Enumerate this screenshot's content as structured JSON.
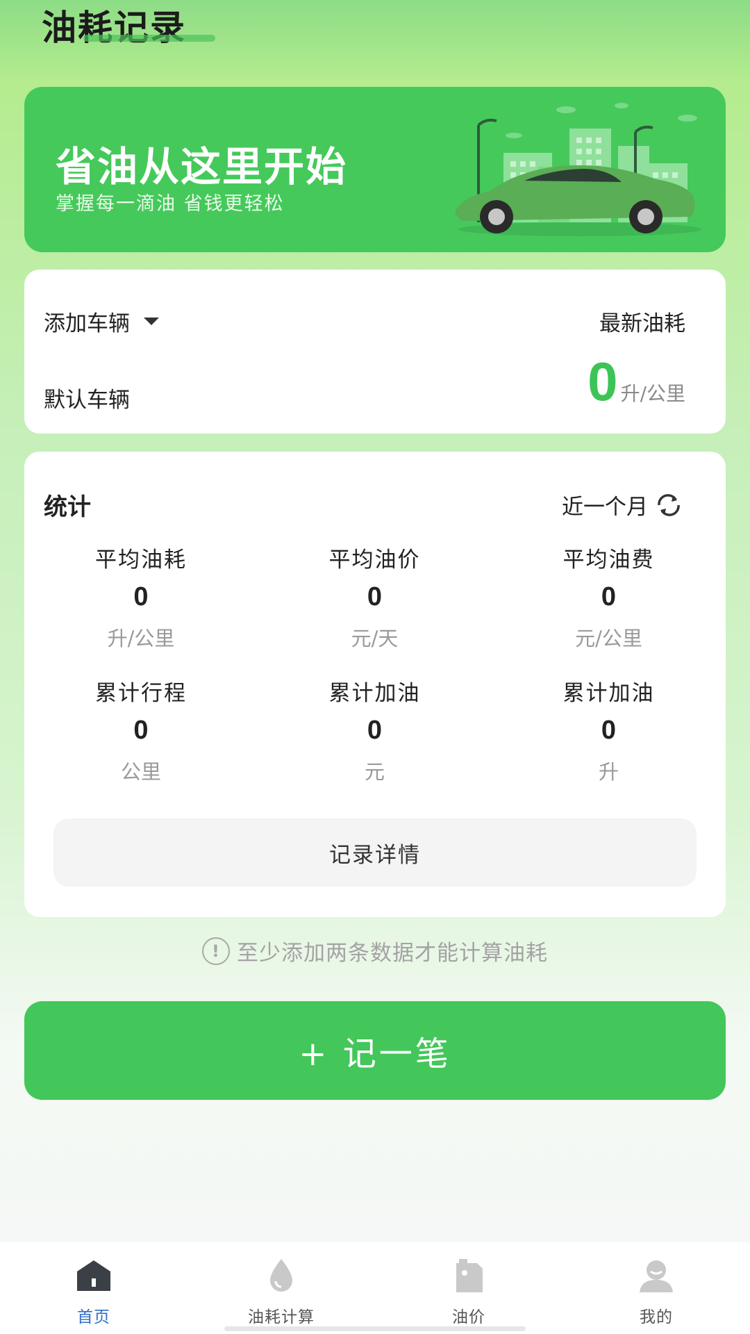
{
  "header": {
    "title": "油耗记录"
  },
  "banner": {
    "title": "省油从这里开始",
    "subtitle": "掌握每一滴油 省钱更轻松"
  },
  "vehicle": {
    "select_label": "添加车辆",
    "latest_label": "最新油耗",
    "name": "默认车辆",
    "latest_value": "0",
    "latest_unit": "升/公里"
  },
  "stats": {
    "title": "统计",
    "period": "近一个月",
    "items": [
      {
        "label": "平均油耗",
        "value": "0",
        "unit": "升/公里"
      },
      {
        "label": "平均油价",
        "value": "0",
        "unit": "元/天"
      },
      {
        "label": "平均油费",
        "value": "0",
        "unit": "元/公里"
      },
      {
        "label": "累计行程",
        "value": "0",
        "unit": "公里"
      },
      {
        "label": "累计加油",
        "value": "0",
        "unit": "元"
      },
      {
        "label": "累计加油",
        "value": "0",
        "unit": "升"
      }
    ],
    "detail_button": "记录详情"
  },
  "hint": "至少添加两条数据才能计算油耗",
  "record_button": "+ 记一笔",
  "nav": [
    {
      "label": "首页",
      "icon": "home-icon",
      "active": true
    },
    {
      "label": "油耗计算",
      "icon": "drop-icon",
      "active": false
    },
    {
      "label": "油价",
      "icon": "fuel-can-icon",
      "active": false
    },
    {
      "label": "我的",
      "icon": "user-icon",
      "active": false
    }
  ],
  "colors": {
    "accent": "#43c65a",
    "active_nav": "#2e6fc4"
  }
}
